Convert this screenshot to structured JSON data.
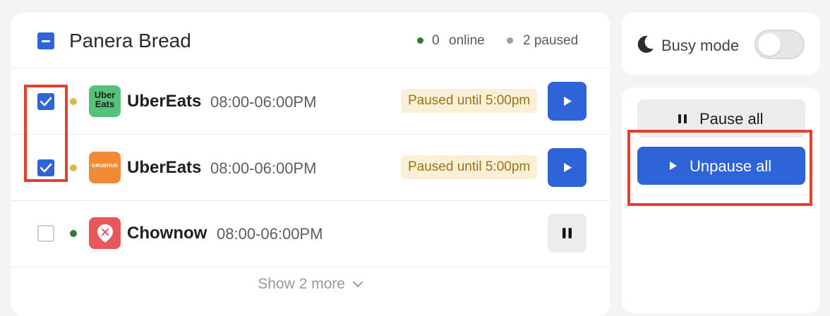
{
  "store": {
    "name": "Panera Bread",
    "online_count": "0",
    "online_label": "online",
    "paused_count": "2",
    "paused_label": "2 paused",
    "colors": {
      "online": "#2e7d32",
      "paused": "#9e9e9e"
    }
  },
  "integrations": [
    {
      "name": "UberEats",
      "logo_text": "Uber\nEats",
      "logo_icon": "ubereats-logo",
      "hours": "08:00-06:00PM",
      "status": "paused",
      "badge": "Paused until 5:00pm",
      "checked": true,
      "action": "play"
    },
    {
      "name": "UberEats",
      "logo_text": "GRUBHUB",
      "logo_icon": "grubhub-logo",
      "hours": "08:00-06:00PM",
      "status": "paused",
      "badge": "Paused until 5:00pm",
      "checked": true,
      "action": "play"
    },
    {
      "name": "Chownow",
      "logo_icon": "chownow-logo",
      "hours": "08:00-06:00PM",
      "status": "online",
      "checked": false,
      "action": "pause"
    }
  ],
  "show_more_label": "Show 2 more",
  "busy_mode": {
    "label": "Busy mode",
    "enabled": false
  },
  "actions": {
    "pause_all_label": "Pause all",
    "unpause_all_label": "Unpause all"
  },
  "colors": {
    "accent": "#2f64d8",
    "paused_dot": "#dbb94a",
    "online_dot": "#2e7d32",
    "badge_bg": "#fbf0d7",
    "badge_text": "#9a7417",
    "highlight": "#e0412a"
  }
}
